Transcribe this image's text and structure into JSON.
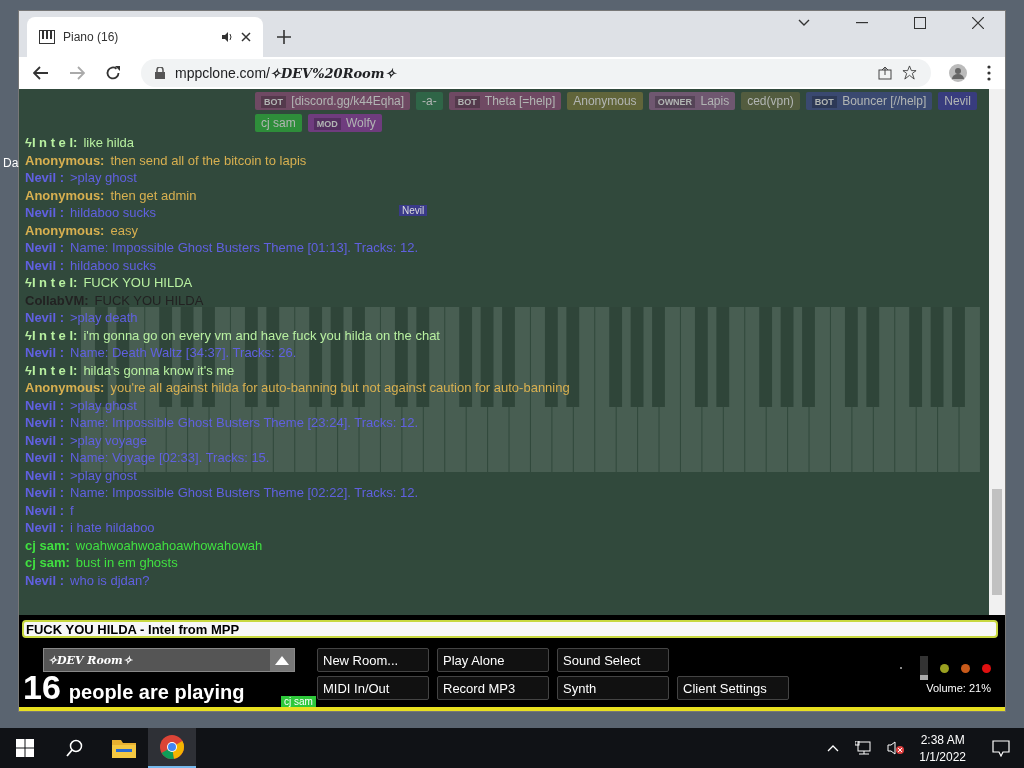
{
  "desktop": {
    "icon_label": "Da"
  },
  "browser": {
    "tab": {
      "title": "Piano (16)",
      "selected": true
    },
    "url_host": "mppclone.com/",
    "url_path": "✧DEV%20Room✧"
  },
  "participants": [
    {
      "badge": "BOT",
      "name": "[discord.gg/k44Eqha]",
      "color": "#7a4a6a"
    },
    {
      "name": "-a-",
      "color": "#2f6a4a"
    },
    {
      "badge": "BOT",
      "name": "Theta [=help]",
      "color": "#7a4a6a"
    },
    {
      "name": "Anonymous",
      "color": "#6a6a3a"
    },
    {
      "badge": "OWNER",
      "name": "Lapis",
      "color": "#7a5a7a"
    },
    {
      "name": "ced(vpn)",
      "color": "#5a6040"
    },
    {
      "badge": "BOT",
      "name": "Bouncer [//help]",
      "color": "#3c4a7a"
    },
    {
      "name": "Nevil",
      "color": "#3a3a8a"
    },
    {
      "name": "cj sam",
      "color": "#2e9a3a"
    },
    {
      "badge": "MOD",
      "name": "Wolfy",
      "color": "#7a3a8a"
    }
  ],
  "messages": [
    {
      "author": "ϟI n t e l:",
      "text": "like hilda",
      "color": "#b8f0a0"
    },
    {
      "author": "Anonymous:",
      "text": "then send all of the bitcoin to lapis",
      "color": "#d8b050"
    },
    {
      "author": "Nevil :",
      "text": ">play ghost",
      "color": "#6060e0"
    },
    {
      "author": "Anonymous:",
      "text": "then get admin",
      "color": "#d8b050"
    },
    {
      "author": "Nevil :",
      "text": "hildaboo sucks",
      "color": "#6060e0"
    },
    {
      "author": "Anonymous:",
      "text": "easy",
      "color": "#d8b050"
    },
    {
      "author": "Nevil :",
      "text": "Name: Impossible Ghost Busters Theme [01:13]. Tracks: 12.",
      "color": "#6060e0"
    },
    {
      "author": "Nevil :",
      "text": "hildaboo sucks",
      "color": "#6060e0"
    },
    {
      "author": "ϟI n t e l:",
      "text": "FUCK YOU HILDA",
      "color": "#b8f0a0"
    },
    {
      "author": "CollabVM:",
      "text": "FUCK YOU HILDA",
      "color": "#222222"
    },
    {
      "author": "Nevil :",
      "text": ">play death",
      "color": "#6060e0"
    },
    {
      "author": "ϟI n t e l:",
      "text": "i'm gonna go on every vm and have fuck you hilda on the chat",
      "color": "#b8f0a0"
    },
    {
      "author": "Nevil :",
      "text": "Name: Death Waltz [34:37]. Tracks: 26.",
      "color": "#6060e0"
    },
    {
      "author": "ϟI n t e l:",
      "text": "hilda's gonna know it's me",
      "color": "#b8f0a0"
    },
    {
      "author": "Anonymous:",
      "text": "you're all against hilda for auto-banning but not against caution for auto-banning",
      "color": "#d8b050"
    },
    {
      "author": "Nevil :",
      "text": ">play ghost",
      "color": "#6060e0"
    },
    {
      "author": "Nevil :",
      "text": "Name: Impossible Ghost Busters Theme [23:24]. Tracks: 12.",
      "color": "#6060e0"
    },
    {
      "author": "Nevil :",
      "text": ">play voyage",
      "color": "#6060e0"
    },
    {
      "author": "Nevil :",
      "text": "Name: Voyage [02:33]. Tracks: 15.",
      "color": "#6060e0"
    },
    {
      "author": "Nevil :",
      "text": ">play ghost",
      "color": "#6060e0"
    },
    {
      "author": "Nevil :",
      "text": "Name: Impossible Ghost Busters Theme [02:22]. Tracks: 12.",
      "color": "#6060e0"
    },
    {
      "author": "Nevil :",
      "text": "f",
      "color": "#6060e0"
    },
    {
      "author": "Nevil :",
      "text": "i hate hildaboo",
      "color": "#6060e0"
    },
    {
      "author": "cj sam:",
      "text": "woahwoahwoahoawhowahowah",
      "color": "#40e040"
    },
    {
      "author": "cj sam:",
      "text": "bust in em ghosts",
      "color": "#40e040"
    },
    {
      "author": "Nevil :",
      "text": "who is djdan?",
      "color": "#6060e0"
    }
  ],
  "cursors": [
    {
      "name": "Nevil",
      "color": "#3a3a8a"
    },
    {
      "name": "cj sam",
      "color": "#2ec83a"
    }
  ],
  "chat_input": {
    "value": "FUCK YOU HILDA - Intel from MPP"
  },
  "room_select": {
    "value": "✧DEV Room✧"
  },
  "player_count": {
    "number": "16",
    "label": "people are playing"
  },
  "buttons": [
    [
      "New Room...",
      "Play Alone",
      "Sound Select"
    ],
    [
      "MIDI In/Out",
      "Record MP3",
      "Synth",
      "Client Settings"
    ]
  ],
  "indicators": [
    {
      "color": "#9aa020"
    },
    {
      "color": "#c85a1a"
    },
    {
      "color": "#e01010"
    }
  ],
  "volume": {
    "level": 0.21,
    "label": "Volume: 21%"
  },
  "taskbar": {
    "time": "2:38 AM",
    "date": "1/1/2022",
    "apps": [
      {
        "kind": "explorer",
        "selected": false
      },
      {
        "kind": "chrome",
        "selected": true
      }
    ]
  }
}
